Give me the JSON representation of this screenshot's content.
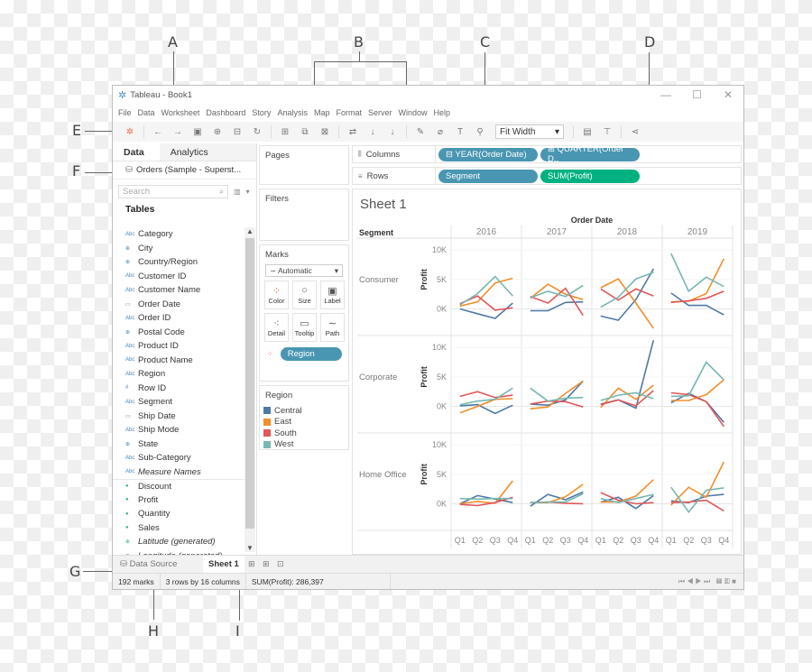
{
  "callouts": [
    "A",
    "B",
    "C",
    "D",
    "E",
    "F",
    "G",
    "H",
    "I"
  ],
  "window": {
    "title": "Tableau - Book1",
    "controls": {
      "minimize": "—",
      "maximize": "☐",
      "close": "✕"
    }
  },
  "menu": [
    "File",
    "Data",
    "Worksheet",
    "Dashboard",
    "Story",
    "Analysis",
    "Map",
    "Format",
    "Server",
    "Window",
    "Help"
  ],
  "toolbar": {
    "icons": [
      "tableau-logo-icon",
      "undo-icon",
      "redo-icon",
      "save-icon",
      "new-datasource-icon",
      "pause-updates-icon",
      "refresh-icon",
      "new-worksheet-icon",
      "duplicate-icon",
      "clear-icon",
      "swap-icon",
      "sort-ascending-icon",
      "sort-descending-icon",
      "highlight-icon",
      "group-icon",
      "show-labels-icon",
      "fix-axes-icon",
      "presentation-icon",
      "share-icon"
    ],
    "fit_label": "Fit Width"
  },
  "left_pane": {
    "tabs": [
      {
        "label": "Data",
        "active": true
      },
      {
        "label": "Analytics",
        "active": false
      }
    ],
    "datasource": "Orders (Sample - Superst...",
    "search_placeholder": "Search",
    "tables_heading": "Tables",
    "fields": [
      {
        "name": "Category",
        "type": "string"
      },
      {
        "name": "City",
        "type": "geo"
      },
      {
        "name": "Country/Region",
        "type": "geo"
      },
      {
        "name": "Customer ID",
        "type": "string"
      },
      {
        "name": "Customer Name",
        "type": "string"
      },
      {
        "name": "Order Date",
        "type": "date"
      },
      {
        "name": "Order ID",
        "type": "string"
      },
      {
        "name": "Postal Code",
        "type": "geo"
      },
      {
        "name": "Product ID",
        "type": "string"
      },
      {
        "name": "Product Name",
        "type": "string"
      },
      {
        "name": "Region",
        "type": "string"
      },
      {
        "name": "Row ID",
        "type": "number"
      },
      {
        "name": "Segment",
        "type": "string"
      },
      {
        "name": "Ship Date",
        "type": "date"
      },
      {
        "name": "Ship Mode",
        "type": "string"
      },
      {
        "name": "State",
        "type": "geo"
      },
      {
        "name": "Sub-Category",
        "type": "string"
      },
      {
        "name": "Measure Names",
        "type": "string",
        "italic": true
      },
      {
        "name": "Discount",
        "type": "measure",
        "divider": true
      },
      {
        "name": "Profit",
        "type": "measure"
      },
      {
        "name": "Quantity",
        "type": "measure"
      },
      {
        "name": "Sales",
        "type": "measure"
      },
      {
        "name": "Latitude (generated)",
        "type": "geo-measure",
        "italic": true
      },
      {
        "name": "Longitude (generated)",
        "type": "geo-measure",
        "italic": true
      }
    ]
  },
  "cards": {
    "pages": "Pages",
    "filters": "Filters",
    "marks": {
      "title": "Marks",
      "type": "Automatic",
      "buttons": [
        {
          "label": "Color",
          "icon": "color-icon"
        },
        {
          "label": "Size",
          "icon": "size-icon"
        },
        {
          "label": "Label",
          "icon": "label-icon"
        },
        {
          "label": "Detail",
          "icon": "detail-icon"
        },
        {
          "label": "Tooltip",
          "icon": "tooltip-icon"
        },
        {
          "label": "Path",
          "icon": "path-icon"
        }
      ],
      "color_pill": "Region"
    },
    "legend": {
      "title": "Region",
      "items": [
        {
          "label": "Central",
          "color": "#4e79a7"
        },
        {
          "label": "East",
          "color": "#f28e2b"
        },
        {
          "label": "South",
          "color": "#e15759"
        },
        {
          "label": "West",
          "color": "#76b7b2"
        }
      ]
    }
  },
  "shelves": {
    "columns": {
      "label": "Columns",
      "pills": [
        "⊟ YEAR(Order Date)",
        "⊞ QUARTER(Order D.."
      ]
    },
    "rows": {
      "label": "Rows",
      "pills": [
        "Segment",
        "SUM(Profit)"
      ]
    }
  },
  "sheet": {
    "title": "Sheet 1"
  },
  "bottom": {
    "datasource_tab": "Data Source",
    "sheet_tab": "Sheet 1"
  },
  "status": {
    "marks": "192 marks",
    "dims": "3 rows by 16 columns",
    "sum": "SUM(Profit): 286,397"
  },
  "chart_data": {
    "type": "line",
    "title": "Sheet 1",
    "column_header": "Order Date",
    "row_header": "Segment",
    "ylabel": "Profit",
    "years": [
      "2016",
      "2017",
      "2018",
      "2019"
    ],
    "quarters": [
      "Q1",
      "Q2",
      "Q3",
      "Q4"
    ],
    "yticks": [
      "10K",
      "5K",
      "0K"
    ],
    "ytick_values": [
      10,
      5,
      0
    ],
    "ylim": [
      -4.5,
      12
    ],
    "units": "thousands",
    "legend": "left-panel",
    "series_colors": {
      "Central": "#4e79a7",
      "East": "#f28e2b",
      "South": "#e15759",
      "West": "#76b7b2"
    },
    "segments": [
      {
        "name": "Consumer",
        "series": {
          "Central": [
            [
              0.0,
              -0.8,
              -1.6,
              1.0
            ],
            [
              -0.3,
              -0.3,
              1.1,
              1.2
            ],
            [
              -1.2,
              -1.9,
              1.6,
              6.8
            ],
            [
              2.7,
              0.6,
              0.6,
              -1.0
            ]
          ],
          "East": [
            [
              0.5,
              1.2,
              4.4,
              5.2
            ],
            [
              1.8,
              4.2,
              2.5,
              1.6
            ],
            [
              3.6,
              5.1,
              1.0,
              -3.3
            ],
            [
              1.2,
              1.3,
              2.6,
              8.5
            ]
          ],
          "South": [
            [
              0.9,
              2.2,
              -0.2,
              0.2
            ],
            [
              2.1,
              1.0,
              3.5,
              -1.1
            ],
            [
              3.4,
              1.5,
              3.4,
              2.2
            ],
            [
              1.1,
              1.4,
              1.8,
              3.0
            ]
          ],
          "West": [
            [
              0.7,
              2.6,
              5.5,
              2.2
            ],
            [
              1.9,
              3.0,
              2.1,
              4.0
            ],
            [
              0.3,
              2.0,
              5.1,
              6.2
            ],
            [
              9.4,
              3.0,
              5.4,
              3.8
            ]
          ]
        }
      },
      {
        "name": "Corporate",
        "series": {
          "Central": [
            [
              0.1,
              0.3,
              -1.2,
              0.2
            ],
            [
              0.4,
              0.2,
              1.1,
              4.3
            ],
            [
              0.4,
              1.1,
              -0.3,
              11.2
            ],
            [
              0.6,
              2.2,
              0.8,
              -2.7
            ]
          ],
          "East": [
            [
              -1.1,
              0.0,
              1.2,
              1.3
            ],
            [
              -0.4,
              -0.1,
              2.2,
              4.3
            ],
            [
              -0.2,
              3.1,
              1.2,
              3.6
            ],
            [
              1.0,
              1.0,
              2.0,
              4.5
            ]
          ],
          "South": [
            [
              1.7,
              2.5,
              1.5,
              1.9
            ],
            [
              0.4,
              0.9,
              0.8,
              -0.1
            ],
            [
              0.3,
              1.1,
              0.1,
              2.7
            ],
            [
              2.3,
              2.0,
              0.8,
              -3.4
            ]
          ],
          "West": [
            [
              0.3,
              0.9,
              1.2,
              3.1
            ],
            [
              3.1,
              0.9,
              1.4,
              1.5
            ],
            [
              1.0,
              1.9,
              2.3,
              1.3
            ],
            [
              1.7,
              1.8,
              7.5,
              4.5
            ]
          ]
        }
      },
      {
        "name": "Home Office",
        "series": {
          "Central": [
            [
              0.0,
              1.4,
              0.8,
              0.2
            ],
            [
              -0.4,
              1.6,
              0.7,
              2.0
            ],
            [
              0.3,
              1.1,
              -0.8,
              1.4
            ],
            [
              0.5,
              0.2,
              1.3,
              1.6
            ]
          ],
          "East": [
            [
              0.0,
              0.4,
              0.1,
              3.9
            ],
            [
              0.2,
              0.2,
              1.2,
              3.3
            ],
            [
              0.3,
              0.3,
              1.3,
              4.1
            ],
            [
              -0.2,
              2.8,
              1.1,
              7.1
            ]
          ],
          "South": [
            [
              -0.1,
              -0.3,
              0.2,
              1.1
            ],
            [
              0.2,
              0.3,
              0.1,
              0.0
            ],
            [
              1.9,
              0.6,
              0.0,
              0.2
            ],
            [
              0.2,
              0.3,
              0.6,
              -1.2
            ]
          ],
          "West": [
            [
              0.9,
              0.8,
              0.9,
              0.9
            ],
            [
              0.2,
              0.3,
              0.3,
              1.7
            ],
            [
              0.9,
              0.2,
              0.9,
              1.6
            ],
            [
              2.8,
              -1.4,
              2.3,
              2.7
            ]
          ]
        }
      }
    ]
  }
}
